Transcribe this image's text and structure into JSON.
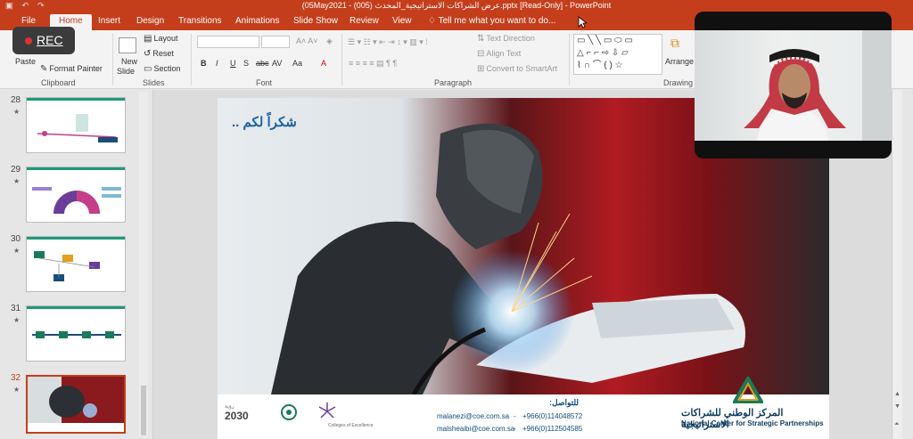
{
  "window": {
    "title": "(05May2021 - (005) عرض الشراكات الاستراتيجية_المحدث.pptx [Read-Only] - PowerPoint"
  },
  "ribbon_tabs": [
    {
      "label": "File"
    },
    {
      "label": "Home"
    },
    {
      "label": "Insert"
    },
    {
      "label": "Design"
    },
    {
      "label": "Transitions"
    },
    {
      "label": "Animations"
    },
    {
      "label": "Slide Show"
    },
    {
      "label": "Review"
    },
    {
      "label": "View"
    }
  ],
  "tell_me": "Tell me what you want to do...",
  "clipboard": {
    "paste": "Paste",
    "format_painter": "Format Painter",
    "group": "Clipboard"
  },
  "slides_group": {
    "new_slide_1": "New",
    "new_slide_2": "Slide",
    "layout": "Layout",
    "reset": "Reset",
    "section": "Section",
    "group": "Slides"
  },
  "font_group": {
    "bold": "B",
    "italic": "I",
    "underline": "U",
    "shadow": "S",
    "strike": "abc",
    "spacing": "AV",
    "case": "Aa",
    "color": "A",
    "group": "Font"
  },
  "paragraph_group": {
    "text_direction": "Text Direction",
    "align_text": "Align Text",
    "convert_smartart": "Convert to SmartArt",
    "group": "Paragraph"
  },
  "drawing_group": {
    "arrange": "Arrange",
    "group": "Drawing"
  },
  "recording": {
    "label": "REC",
    "dot_color": "#e03030"
  },
  "thumbnails": [
    {
      "number": "28",
      "star": "★"
    },
    {
      "number": "29",
      "star": "★"
    },
    {
      "number": "30",
      "star": "★"
    },
    {
      "number": "31",
      "star": "★"
    },
    {
      "number": "32",
      "star": "★"
    }
  ],
  "slide": {
    "thanks": "شكراً لكم ..",
    "contact_title": "للتواصل:",
    "email1": "malanezi@coe.com.sa",
    "phone1": "+966(0)114048572",
    "email2": "malsheaibi@coe.com.sa",
    "phone2": "+966(0)112504585",
    "dash": "-",
    "org_ar": "المركز الوطني للشراكات الاستراتيجية",
    "org_en": "National Center for Strategic Partnerships",
    "vision": "2030",
    "vision_ar": "رؤية",
    "colleges": "Colleges of Excellence"
  },
  "colors": {
    "accent": "#c43e1c",
    "ribbon_bg": "#f3f3f3",
    "teal": "#1e9a7a",
    "slide_red": "#b01c22",
    "brand_blue": "#0c3a5c"
  }
}
